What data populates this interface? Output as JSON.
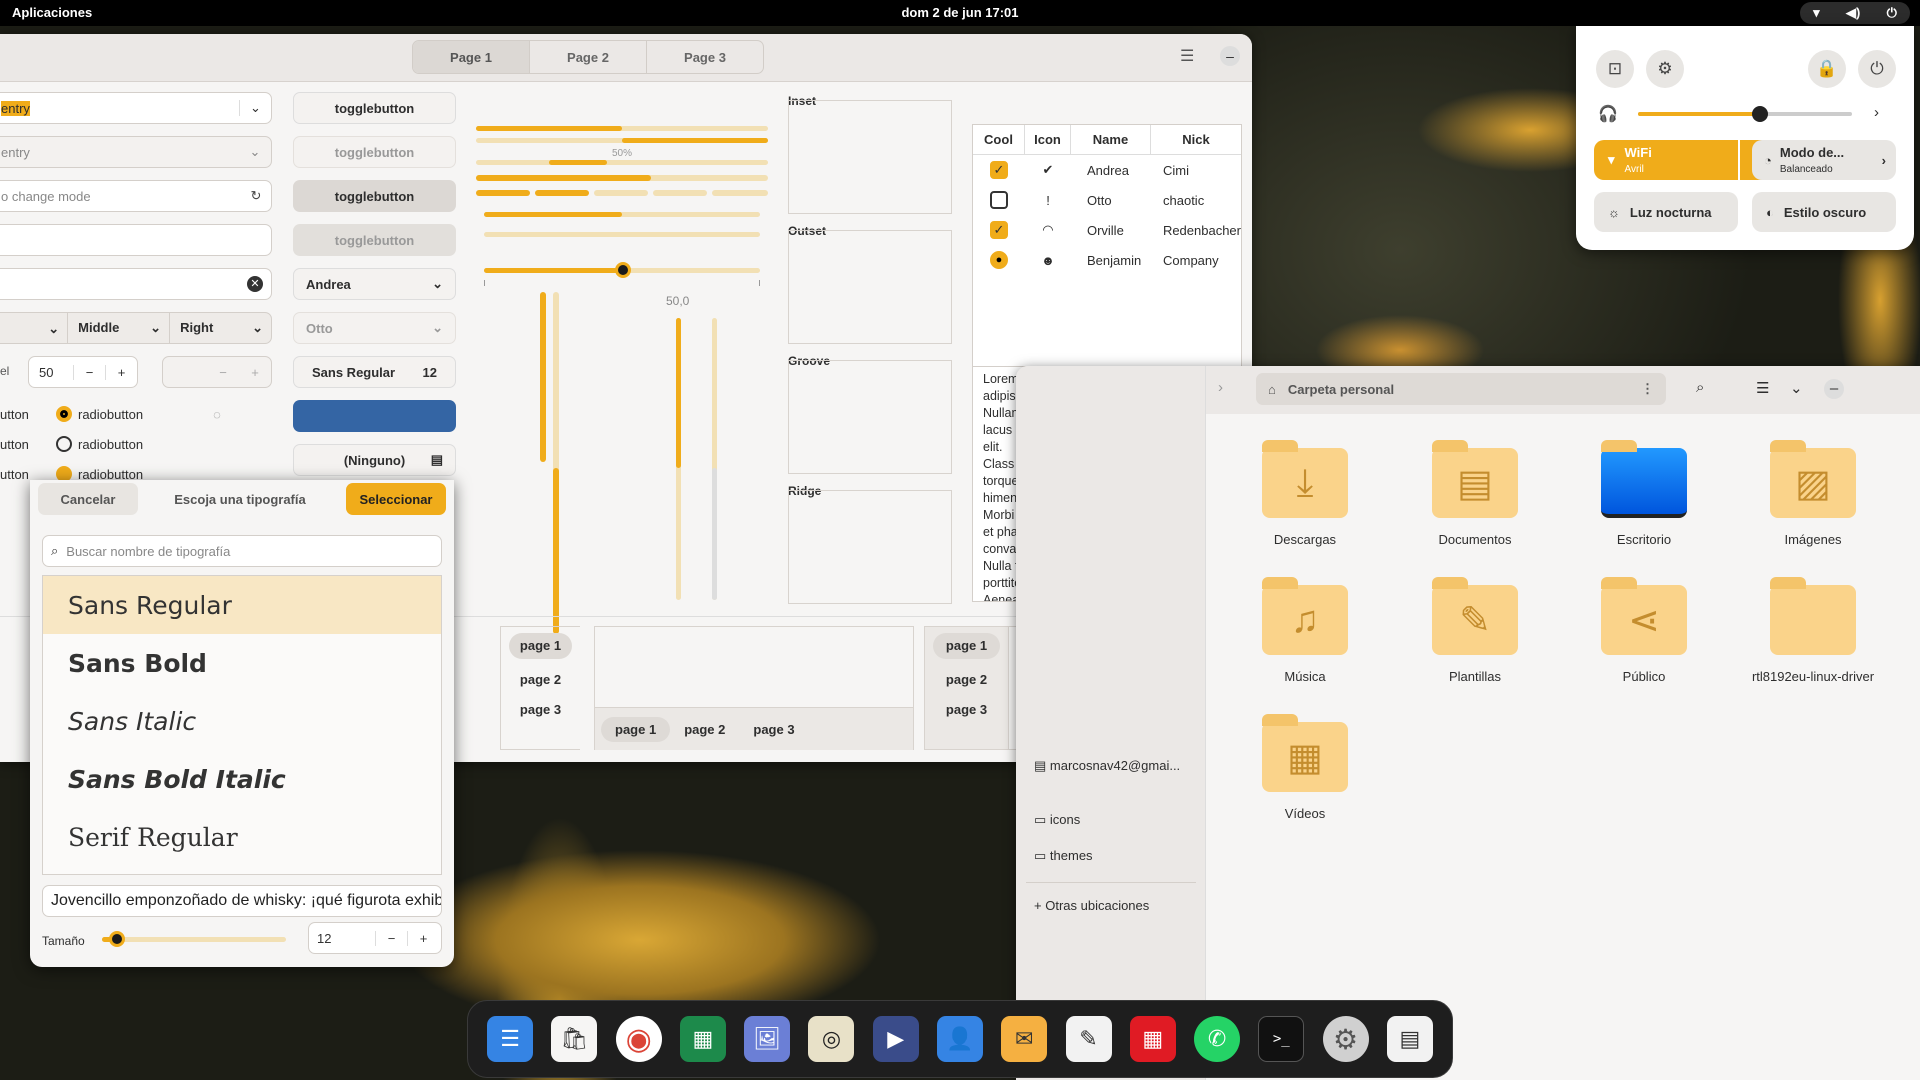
{
  "topbar": {
    "apps": "Aplicaciones",
    "clock": "dom 2 de jun  17:01",
    "tray": "▾ ◀) ⏻"
  },
  "wf": {
    "tabs": [
      "Page 1",
      "Page 2",
      "Page 3"
    ],
    "entries": {
      "e1": "entry",
      "e2": "entry",
      "e3": "o change mode"
    },
    "combos": {
      "left": "",
      "middle": "Middle",
      "right": "Right"
    },
    "spin": {
      "val": "50",
      "label": "el"
    },
    "radio_labels": [
      "utton",
      "utton",
      "utton",
      "utton",
      "utton"
    ],
    "radios": [
      "radiobutton",
      "radiobutton",
      "radiobutton"
    ],
    "toggles": [
      "togglebutton",
      "togglebutton",
      "togglebutton",
      "togglebutton"
    ],
    "combo_andrea": "Andrea",
    "combo_otto": "Otto",
    "font_btn": {
      "name": "Sans Regular",
      "size": "12"
    },
    "file_btn": "(Ninguno)",
    "progress_label": "50%",
    "scale_label": "50,0",
    "progress_fraction": 0.5,
    "frames": [
      "Inset",
      "Outset",
      "Groove",
      "Ridge"
    ],
    "table": {
      "headers": [
        "Cool",
        "Icon",
        "Name",
        "Nick"
      ],
      "rows": [
        {
          "cool": "✓",
          "icon": "✔",
          "name": "Andrea",
          "nick": "Cimi"
        },
        {
          "cool": "",
          "icon": "!",
          "name": "Otto",
          "nick": "chaotic"
        },
        {
          "cool": "✓",
          "icon": "◠",
          "name": "Orville",
          "nick": "Redenbacher"
        },
        {
          "cool": "●",
          "icon": "☻",
          "name": "Benjamin",
          "nick": "Company"
        }
      ]
    },
    "text": "Lorem ipsum dolor sit amet, consectetur adipiscing elit.\nNullam fringilla, est ut feugiat ultrices, elit lacus ultricies nibh, id commodo tortor nisi id elit.\nClass aptent taciti sociosqu ad litora torquent per conubia nostra, per inceptos himenaeos.\nMorbi vel elit erat. Maecenas dignissim, dui et pharetra rutrum, tellus lectus rutrum mi, a convallis libero nisi quis tellus.\nNulla facilisi. Nullam eleifend lobortis nisl, in porttitor tellus malesuada vitae.\nAenean lacus tellus, pellentesque quis",
    "nb_pages": [
      "page 1",
      "page 2",
      "page 3"
    ]
  },
  "fontdlg": {
    "cancel": "Cancelar",
    "title": "Escoja una tipografía",
    "select": "Seleccionar",
    "search_placeholder": "Buscar nombre de tipografía",
    "fonts": [
      "Sans Regular",
      "Sans Bold",
      "Sans Italic",
      "Sans Bold Italic",
      "Serif Regular"
    ],
    "preview": "Jovencillo emponzoñado de whisky: ¡qué figurota exhibe!",
    "size_label": "Tamaño",
    "size_val": "12",
    "size_fraction": 0.08
  },
  "files": {
    "path": "Carpeta personal",
    "sidebar": [
      "marcosnav42@gmai...",
      "icons",
      "themes",
      "Otras ubicaciones"
    ],
    "folders": [
      "Descargas",
      "Documentos",
      "Escritorio",
      "Imágenes",
      "Música",
      "Plantillas",
      "Público",
      "rtl8192eu-linux-driver",
      "Vídeos"
    ]
  },
  "qs": {
    "volume_fraction": 0.57,
    "wifi": "WiFi",
    "wifi_sub": "Avril",
    "power": "Modo de...",
    "power_sub": "Balanceado",
    "night": "Luz nocturna",
    "dark": "Estilo oscuro"
  },
  "dock": [
    "☰",
    "🛍",
    "◉",
    "▦",
    "🖼",
    "◎",
    "▶",
    "👤",
    "✉",
    "✎",
    "▦",
    "✆",
    ">_",
    "⚙",
    "▤"
  ],
  "colors": {
    "accent": "#f0ac1a"
  }
}
